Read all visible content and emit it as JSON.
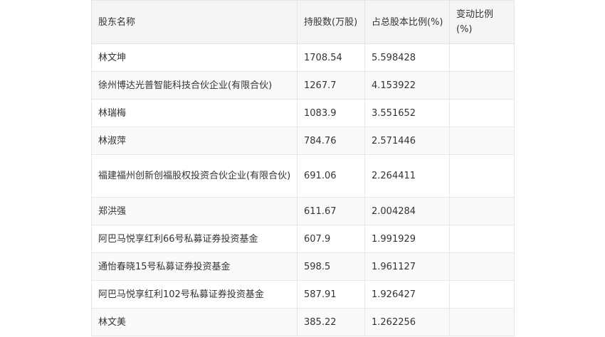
{
  "table": {
    "headers": [
      "股东名称",
      "持股数(万股)",
      "占总股本比例(%)",
      "变动比例(%)"
    ],
    "rows": [
      [
        "林文坤",
        "1708.54",
        "5.598428",
        ""
      ],
      [
        "徐州博达光普智能科技合伙企业(有限合伙)",
        "1267.7",
        "4.153922",
        ""
      ],
      [
        "林瑞梅",
        "1083.9",
        "3.551652",
        ""
      ],
      [
        "林淑萍",
        "784.76",
        "2.571446",
        ""
      ],
      [
        "福建福州创新创福股权投资合伙企业(有限合伙)",
        "691.06",
        "2.264411",
        ""
      ],
      [
        "郑洪强",
        "611.67",
        "2.004284",
        ""
      ],
      [
        "阿巴马悦享红利66号私募证券投资基金",
        "607.9",
        "1.991929",
        ""
      ],
      [
        "通怡春晓15号私募证券投资基金",
        "598.5",
        "1.961127",
        ""
      ],
      [
        "阿巴马悦享红利102号私募证券投资基金",
        "587.91",
        "1.926427",
        ""
      ],
      [
        "林文美",
        "385.22",
        "1.262256",
        ""
      ]
    ]
  }
}
